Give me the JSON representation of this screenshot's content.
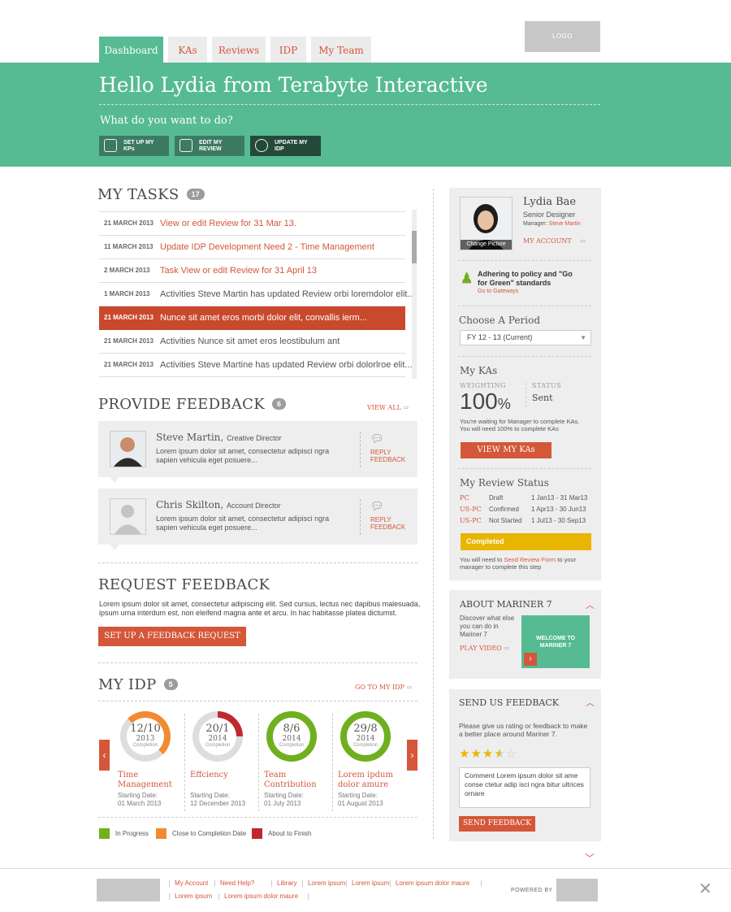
{
  "nav": {
    "tabs": [
      "Dashboard",
      "KAs",
      "Reviews",
      "IDP",
      "My Team"
    ],
    "logo": "LOGO"
  },
  "hero": {
    "greeting": "Hello Lydia from Terabyte Interactive",
    "question": "What do you want to do?",
    "actions": [
      "SET UP MY KPs",
      "EDIT MY REVIEW",
      "UPDATE MY IDP"
    ]
  },
  "tasks": {
    "title": "MY TASKS",
    "count": "17",
    "items": [
      {
        "date": "21 MARCH 2013",
        "text": "View or edit Review for 31 Mar 13."
      },
      {
        "date": "11 MARCH 2013",
        "text": "Update IDP Development Need 2 - Time Management"
      },
      {
        "date": "2 MARCH 2013",
        "text": "Task View or edit Review for 31 April 13"
      },
      {
        "date": "1 MARCH 2013",
        "text": "Activities Steve Martin has updated Review orbi loremdolor elit..."
      },
      {
        "date": "21 MARCH 2013",
        "text": "Nunce sit amet eros morbi dolor elit, convallis ierm..."
      },
      {
        "date": "21 MARCH 2013",
        "text": "Activities Nunce sit amet eros leostibulum ant"
      },
      {
        "date": "21 MARCH 2013",
        "text": "Activities Steve Martine has updated Review orbi dolorlroe elit..."
      }
    ]
  },
  "feedback": {
    "title": "PROVIDE FEEDBACK",
    "count": "6",
    "view_all": "VIEW ALL",
    "reply": "REPLY FEEDBACK",
    "items": [
      {
        "name": "Steve Martin,",
        "role": "Creative Director",
        "text": "Lorem ipsum dolor sit amet, consectetur adipisci ngra sapien vehicula eget posuere..."
      },
      {
        "name": "Chris Skilton,",
        "role": "Account Director",
        "text": "Lorem ipsum dolor sit amet, consectetur adipisci ngra sapien vehicula eget posuere..."
      }
    ]
  },
  "request": {
    "title": "REQUEST FEEDBACK",
    "text": "Lorem ipsum dolor sit amet, consectetur adipiscing elit. Sed cursus, lectus nec dapibus malesuada, ipsum urna interdum est, non eleifend magna ante et arcu. In hac habitasse platea dictumst.",
    "button": "SET UP A FEEDBACK REQUEST"
  },
  "idp": {
    "title": "MY IDP",
    "count": "5",
    "go_to": "GO TO MY IDP",
    "items": [
      {
        "num": "12/10",
        "year": "2013",
        "label": "Completion",
        "name": "Time Management",
        "start_label": "Starting Date:",
        "start": "01 March 2013",
        "color": "#f28a30",
        "progress": 0.35
      },
      {
        "num": "20/1",
        "year": "2014",
        "label": "Completion",
        "name": "Effciency",
        "start_label": "Starting Date:",
        "start": "12 December 2013",
        "color": "#c0282e",
        "progress": 0.15
      },
      {
        "num": "8/6",
        "year": "2014",
        "label": "Completion",
        "name": "Team Contribution",
        "start_label": "Starting Date:",
        "start": "01 July 2013",
        "color": "#6fb01e",
        "progress": 1
      },
      {
        "num": "29/8",
        "year": "2014",
        "label": "Completion",
        "name": "Lorem ipdum dolor amure",
        "start_label": "Starting Date:",
        "start": "01 August 2013",
        "color": "#6fb01e",
        "progress": 1
      }
    ],
    "legend": [
      {
        "label": "In Progress",
        "color": "#6fb01e"
      },
      {
        "label": "Close to Completion Date",
        "color": "#f28a30"
      },
      {
        "label": "About to Finish",
        "color": "#c0282e"
      }
    ]
  },
  "profile": {
    "name": "Lydia Bae",
    "title": "Senior Designer",
    "manager_label": "Manager:",
    "manager": "Steve Martin",
    "my_account": "MY ACCOUNT",
    "change_picture": "Change Picture",
    "policy": "Adhering to policy and \"Go for Green\" standards",
    "gateways": "Go to Gateways"
  },
  "period": {
    "title": "Choose A Period",
    "selected": "FY 12 - 13 (Current)"
  },
  "kas": {
    "title": "My KAs",
    "weighting_label": "WEIGHTING",
    "status_label": "STATUS",
    "weighting": "100",
    "percent": "%",
    "status": "Sent",
    "note": "You're waiting for Manager to complete KAs. You will need 100% to complete KAs",
    "button": "VIEW MY KAs"
  },
  "review_status": {
    "title": "My Review Status",
    "rows": [
      {
        "code": "PC",
        "state": "Draft",
        "dates": "1 Jan13 - 31 Mar13"
      },
      {
        "code": "US-PC",
        "state": "Confirmed",
        "dates": "1 Apr13 - 30 Jun13"
      },
      {
        "code": "US-PC",
        "state": "Not Started",
        "dates": "1 Jul13 - 30 Sep13"
      }
    ],
    "bar": "Completed",
    "note_pre": "You will need to",
    "note_link": "Send Review Form",
    "note_post": "to your manager to complete this step"
  },
  "about": {
    "title": "ABOUT  MARINER 7",
    "text": "Discover what else you can do in Mariner 7",
    "play": "PLAY VIDEO",
    "video": "WELCOME TO MARINER 7"
  },
  "send": {
    "title": "SEND US FEEDBACK",
    "text": "Please give us rating or feedback to make a better place around Mariner 7.",
    "rating": 3.5,
    "comment": "Comment Lorem ipsum dolor sit ame conse ctetur adip isci ngra bitur ultrices ornare",
    "button": "SEND FEEDBACK"
  },
  "footer": {
    "links_row1": [
      "My Account",
      "Need Help?",
      "Library",
      "Lorem ipsum",
      "Lorem ipsum",
      "Lorem ipsum dolor maure"
    ],
    "links_row2": [
      "Lorem ipsum",
      "Lorem ipsum dolor maure"
    ],
    "powered": "POWERED BY"
  }
}
